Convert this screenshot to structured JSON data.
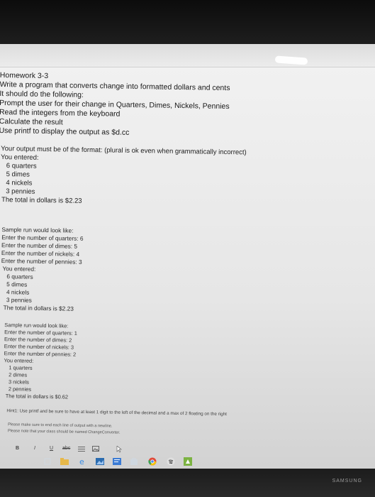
{
  "document": {
    "lines": [
      "Homework 3-3",
      "Write a program that converts change into formatted dollars and cents",
      "It should do the following:",
      "Prompt the user for their change in Quarters, Dimes, Nickels, Pennies",
      "Read the integers from the keyboard",
      "Calculate the result",
      "Use printf to display the output as $d.cc",
      "Your output must be of the format: (plural is ok even when grammatically incorrect)",
      "You entered:",
      "6 quarters",
      "5 dimes",
      "4 nickels",
      "3 pennies",
      "The total in dollars is $2.23",
      "Sample run would look like:",
      "Enter the number of quarters:  6",
      "Enter the number of dimes:  5",
      "Enter the number of nickels:  4",
      "Enter the number of pennies:  3",
      "You entered:",
      "6 quarters",
      "5 dimes",
      "4 nickels",
      "3 pennies",
      "The total in dollars is $2.23",
      "Sample run would look like:",
      "Enter the number of quarters:  1",
      "Enter the number of dimes:  2",
      "Enter the number of nickels:  3",
      "Enter the number of pennies:  2",
      "You entered:",
      "1 quarters",
      "2 dimes",
      "3 nickels",
      "2 pennies",
      "The total in dollars is $0.62",
      "Hint1: Use printf and be sure to have at least 1 digit to the left of the decimal and a max of 2 floating on the right",
      "Please make sure to end each line of output with a newline.",
      "Please note that your class should be named ChangeConverter."
    ]
  },
  "toolbar": {
    "bold": "B",
    "italic": "I",
    "underline": "U",
    "strike": "abc"
  },
  "taskbar": {
    "icons": [
      "task-view-icon",
      "edge-icon",
      "photos-icon",
      "store-icon",
      "chrome-icon",
      "spotify-icon",
      "app-icon"
    ]
  },
  "bezel": {
    "brand": "SAMSUNG"
  }
}
